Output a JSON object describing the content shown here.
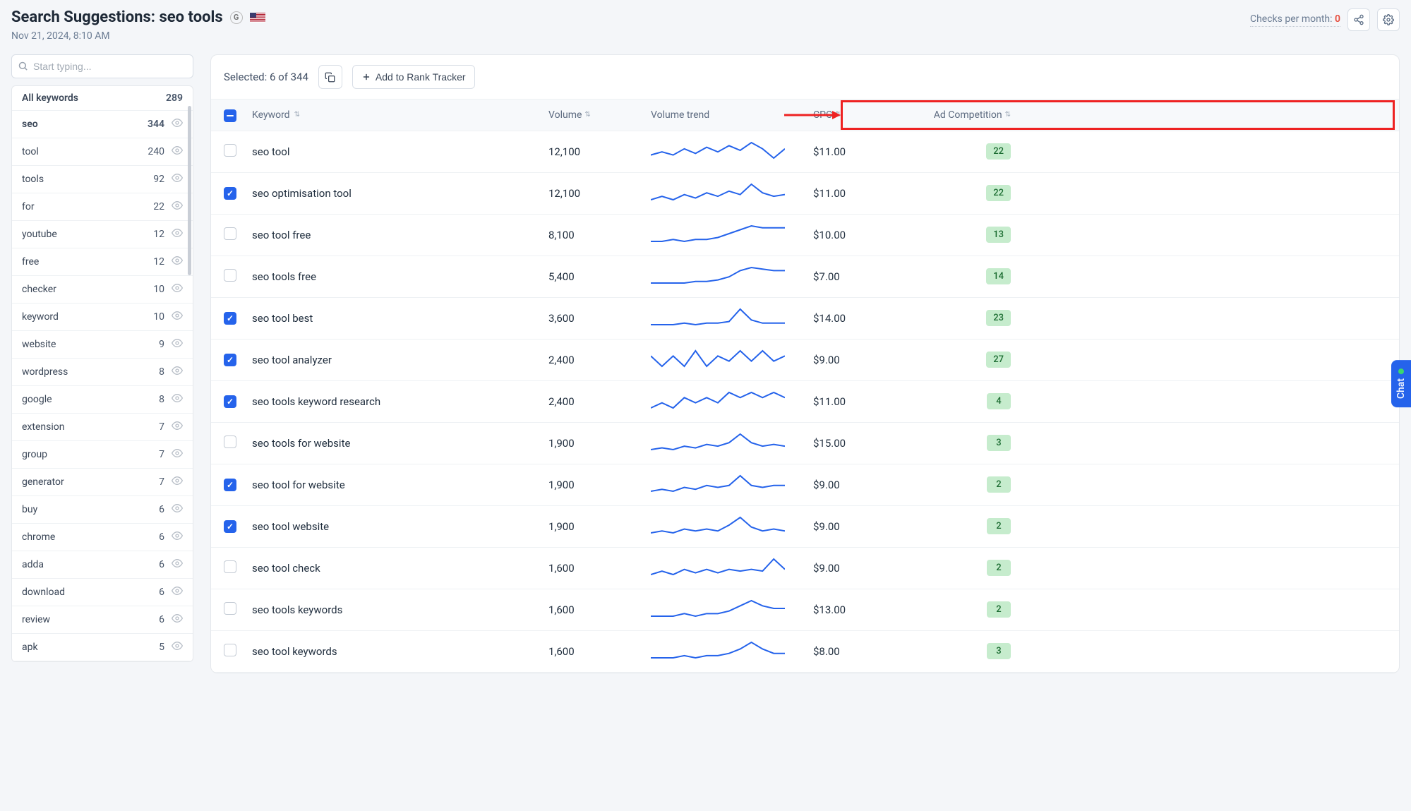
{
  "header": {
    "title_prefix": "Search Suggestions:",
    "query": "seo tools",
    "timestamp": "Nov 21, 2024, 8:10 AM",
    "checks_label": "Checks per month:",
    "checks_value": "0"
  },
  "sidebar": {
    "search_placeholder": "Start typing...",
    "all_label": "All keywords",
    "all_count": "289",
    "items": [
      {
        "label": "seo",
        "count": "344"
      },
      {
        "label": "tool",
        "count": "240"
      },
      {
        "label": "tools",
        "count": "92"
      },
      {
        "label": "for",
        "count": "22"
      },
      {
        "label": "youtube",
        "count": "12"
      },
      {
        "label": "free",
        "count": "12"
      },
      {
        "label": "checker",
        "count": "10"
      },
      {
        "label": "keyword",
        "count": "10"
      },
      {
        "label": "website",
        "count": "9"
      },
      {
        "label": "wordpress",
        "count": "8"
      },
      {
        "label": "google",
        "count": "8"
      },
      {
        "label": "extension",
        "count": "7"
      },
      {
        "label": "group",
        "count": "7"
      },
      {
        "label": "generator",
        "count": "7"
      },
      {
        "label": "buy",
        "count": "6"
      },
      {
        "label": "chrome",
        "count": "6"
      },
      {
        "label": "adda",
        "count": "6"
      },
      {
        "label": "download",
        "count": "6"
      },
      {
        "label": "review",
        "count": "6"
      },
      {
        "label": "apk",
        "count": "5"
      }
    ]
  },
  "toolbar": {
    "selected": "Selected: 6 of 344",
    "add_button": "Add to Rank Tracker"
  },
  "columns": {
    "keyword": "Keyword",
    "volume": "Volume",
    "trend": "Volume trend",
    "cpc": "CPC",
    "ad": "Ad Competition"
  },
  "rows": [
    {
      "checked": false,
      "keyword": "seo tool",
      "volume": "12,100",
      "cpc": "$11.00",
      "ad": "22",
      "trend": [
        10,
        12,
        10,
        14,
        11,
        15,
        12,
        16,
        13,
        18,
        14,
        8,
        14
      ]
    },
    {
      "checked": true,
      "keyword": "seo optimisation tool",
      "volume": "12,100",
      "cpc": "$11.00",
      "ad": "22",
      "trend": [
        11,
        13,
        11,
        14,
        12,
        15,
        13,
        16,
        14,
        20,
        15,
        13,
        14
      ]
    },
    {
      "checked": false,
      "keyword": "seo tool free",
      "volume": "8,100",
      "cpc": "$10.00",
      "ad": "13",
      "trend": [
        10,
        10,
        11,
        10,
        11,
        11,
        12,
        14,
        16,
        18,
        17,
        17,
        17
      ]
    },
    {
      "checked": false,
      "keyword": "seo tools free",
      "volume": "5,400",
      "cpc": "$7.00",
      "ad": "14",
      "trend": [
        10,
        10,
        10,
        10,
        11,
        11,
        12,
        14,
        18,
        20,
        19,
        18,
        18
      ]
    },
    {
      "checked": true,
      "keyword": "seo tool best",
      "volume": "3,600",
      "cpc": "$14.00",
      "ad": "23",
      "trend": [
        10,
        10,
        10,
        11,
        10,
        11,
        11,
        12,
        20,
        13,
        11,
        11,
        11
      ]
    },
    {
      "checked": true,
      "keyword": "seo tool analyzer",
      "volume": "2,400",
      "cpc": "$9.00",
      "ad": "27",
      "trend": [
        12,
        10,
        12,
        10,
        13,
        10,
        12,
        11,
        13,
        11,
        13,
        11,
        12
      ]
    },
    {
      "checked": true,
      "keyword": "seo tools keyword research",
      "volume": "2,400",
      "cpc": "$11.00",
      "ad": "4",
      "trend": [
        11,
        12,
        11,
        13,
        12,
        13,
        12,
        14,
        13,
        14,
        13,
        14,
        13
      ]
    },
    {
      "checked": false,
      "keyword": "seo tools for website",
      "volume": "1,900",
      "cpc": "$15.00",
      "ad": "3",
      "trend": [
        9,
        10,
        9,
        11,
        10,
        12,
        11,
        13,
        18,
        13,
        11,
        12,
        11
      ]
    },
    {
      "checked": true,
      "keyword": "seo tool for website",
      "volume": "1,900",
      "cpc": "$9.00",
      "ad": "2",
      "trend": [
        10,
        11,
        10,
        12,
        11,
        13,
        12,
        13,
        18,
        13,
        12,
        13,
        13
      ]
    },
    {
      "checked": true,
      "keyword": "seo tool website",
      "volume": "1,900",
      "cpc": "$9.00",
      "ad": "2",
      "trend": [
        10,
        11,
        10,
        12,
        11,
        12,
        11,
        14,
        18,
        13,
        11,
        12,
        11
      ]
    },
    {
      "checked": false,
      "keyword": "seo tool check",
      "volume": "1,600",
      "cpc": "$9.00",
      "ad": "2",
      "trend": [
        11,
        13,
        11,
        14,
        12,
        14,
        12,
        14,
        13,
        14,
        13,
        20,
        14
      ]
    },
    {
      "checked": false,
      "keyword": "seo tools keywords",
      "volume": "1,600",
      "cpc": "$13.00",
      "ad": "2",
      "trend": [
        10,
        10,
        10,
        11,
        10,
        11,
        11,
        12,
        14,
        16,
        14,
        13,
        13
      ]
    },
    {
      "checked": false,
      "keyword": "seo tool keywords",
      "volume": "1,600",
      "cpc": "$8.00",
      "ad": "3",
      "trend": [
        10,
        10,
        10,
        11,
        10,
        11,
        11,
        12,
        14,
        17,
        14,
        12,
        12
      ]
    }
  ],
  "chat": {
    "label": "Chat"
  }
}
